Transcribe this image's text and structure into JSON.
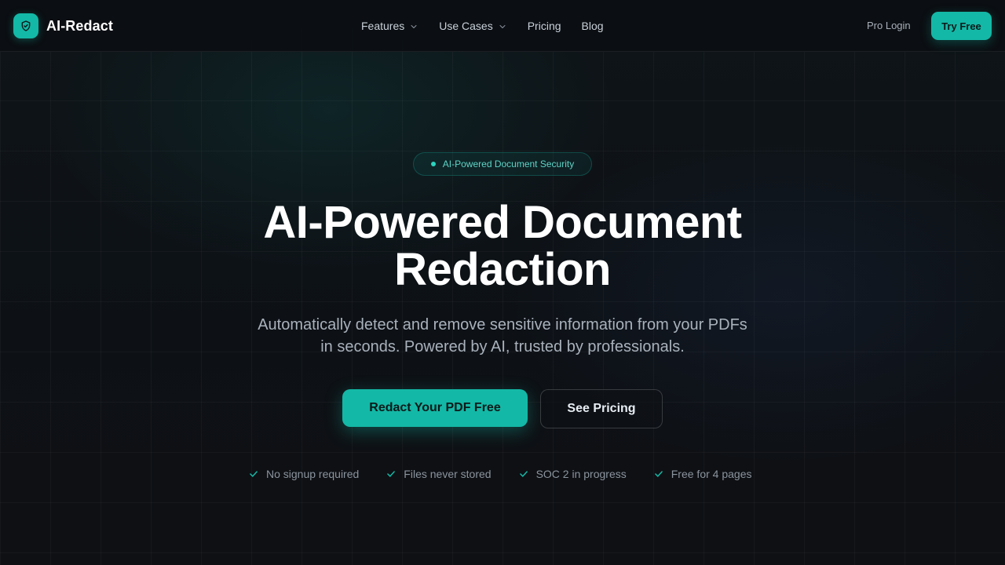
{
  "brand": {
    "name": "AI-Redact",
    "accent_color": "#14b8a6",
    "logo_icon": "shield-check-icon"
  },
  "nav": {
    "items": [
      {
        "label": "Features",
        "has_dropdown": true
      },
      {
        "label": "Use Cases",
        "has_dropdown": true
      },
      {
        "label": "Pricing",
        "has_dropdown": false
      },
      {
        "label": "Blog",
        "has_dropdown": false
      }
    ],
    "pro_login": "Pro Login",
    "try_free": "Try Free"
  },
  "hero": {
    "badge": "AI-Powered Document Security",
    "headline_line1": "AI-Powered Document",
    "headline_line2": "Redaction",
    "subtitle_line1": "Automatically detect and remove sensitive information from your PDFs",
    "subtitle_line2": "in seconds. Powered by AI, trusted by professionals.",
    "primary_cta": "Redact Your PDF Free",
    "secondary_cta": "See Pricing",
    "features": [
      "No signup required",
      "Files never stored",
      "SOC 2 in progress",
      "Free for 4 pages"
    ]
  }
}
